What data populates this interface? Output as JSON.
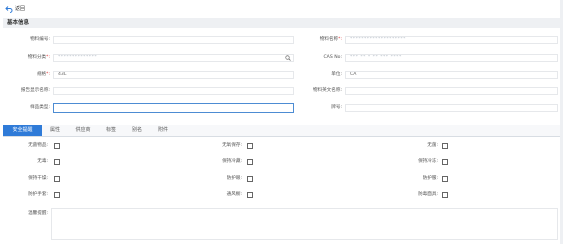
{
  "toolbar": {
    "back_label": "返回"
  },
  "section": {
    "title": "基本信息"
  },
  "form": {
    "material_code": {
      "label": "物料编号:",
      "value": ""
    },
    "material_name": {
      "label": "物料名称",
      "value": "********************"
    },
    "material_category": {
      "label": "物料分类",
      "value": "**************"
    },
    "cas_no": {
      "label": "CAS No:",
      "value": "*** ** * ** *** ****"
    },
    "spec": {
      "label": "规格",
      "value": "43L"
    },
    "unit": {
      "label": "单位:",
      "value": "CA"
    },
    "report_name": {
      "label": "报告显示名称:",
      "value": ""
    },
    "english_name": {
      "label": "物料英文名称:",
      "value": ""
    },
    "sample_type": {
      "label": "样品类型:",
      "value": ""
    },
    "brand": {
      "label": "牌号:",
      "value": ""
    }
  },
  "tabs": [
    "安全提醒",
    "属性",
    "供应商",
    "标签",
    "别名",
    "附件"
  ],
  "safety": {
    "checkboxes": [
      {
        "label": "无菌物品:",
        "checked": false
      },
      {
        "label": "无氧保存:",
        "checked": false
      },
      {
        "label": "无菌:",
        "checked": false
      },
      {
        "label": "无毒:",
        "checked": false
      },
      {
        "label": "保持冷藏:",
        "checked": false
      },
      {
        "label": "保持冷冻:",
        "checked": false
      },
      {
        "label": "保持干燥:",
        "checked": false
      },
      {
        "label": "防护眼:",
        "checked": false
      },
      {
        "label": "防护服:",
        "checked": false
      },
      {
        "label": "防护手套:",
        "checked": false
      },
      {
        "label": "通风橱:",
        "checked": false
      },
      {
        "label": "防毒面具:",
        "checked": false
      }
    ],
    "notes_label": "温馨提醒:"
  }
}
